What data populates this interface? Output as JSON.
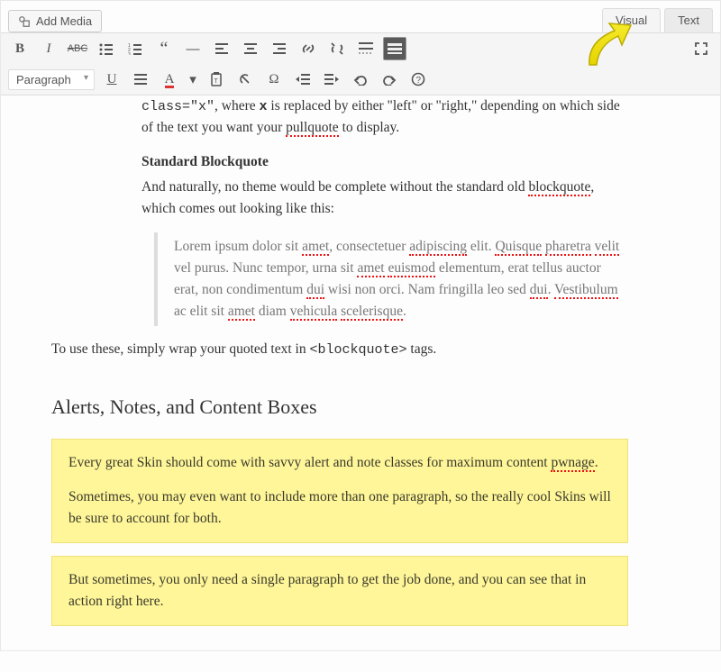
{
  "topbar": {
    "add_media": "Add Media",
    "tab_visual": "Visual",
    "tab_text": "Text"
  },
  "toolbar": {
    "format_select": "Paragraph"
  },
  "body": {
    "line1_a": "class=\"x\"",
    "line1_b": ", where ",
    "line1_x": "x",
    "line1_c": " is replaced by either \"left\" or \"right,\" depending on which side of the text you want your ",
    "line1_pq": "pullquote",
    "line1_d": " to display.",
    "h_std": "Standard Blockquote",
    "std_a": "And naturally, no theme would be complete without the standard old ",
    "std_bq": "blockquote",
    "std_b": ", which comes out looking like this:",
    "lorem": "Lorem ipsum dolor sit amet, consectetuer adipiscing elit. Quisque pharetra velit vel purus. Nunc tempor, urna sit amet euismod elementum, erat tellus auctor erat, non condimentum dui wisi non orci. Nam fringilla leo sed dui. Vestibulum ac elit sit amet diam vehicula scelerisque.",
    "use_a": "To use these, simply wrap your quoted text in ",
    "use_code": "<blockquote>",
    "use_b": " tags.",
    "h_alerts": "Alerts, Notes, and Content Boxes",
    "alert1_p1_a": "Every great Skin should come with savvy alert and note classes for maximum content ",
    "alert1_p1_pw": "pwnage",
    "alert1_p1_b": ".",
    "alert1_p2": "Sometimes, you may even want to include more than one paragraph, so the really cool Skins will be sure to account for both.",
    "alert2_p1": "But sometimes, you only need a single paragraph to get the job done, and you can see that in action right here."
  }
}
